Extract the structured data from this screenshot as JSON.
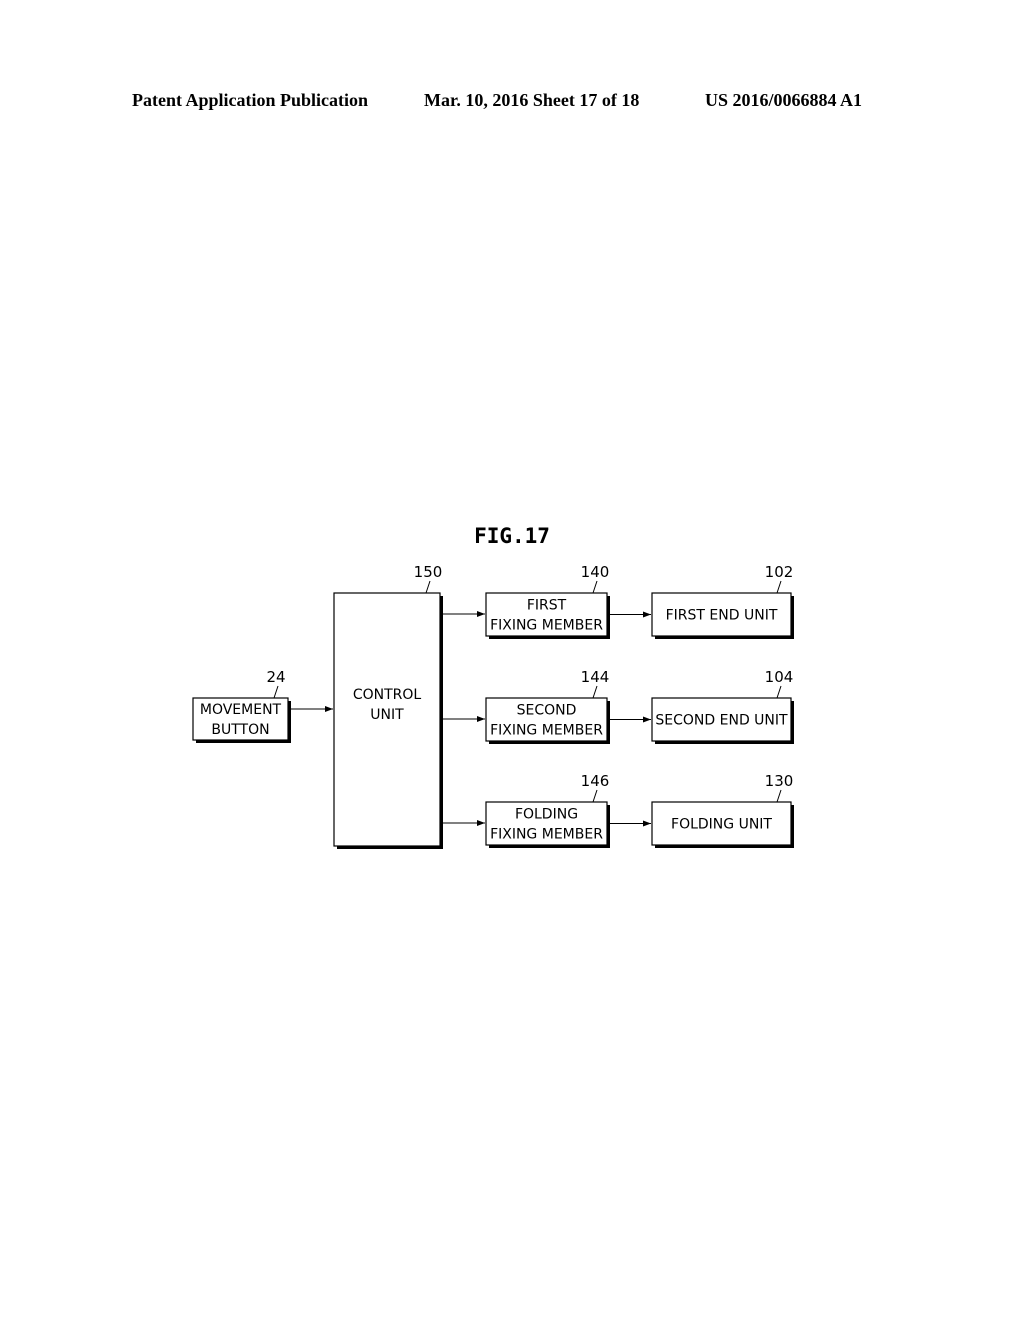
{
  "header": {
    "publication": "Patent Application Publication",
    "date_sheet": "Mar. 10, 2016  Sheet 17 of 18",
    "number": "US 2016/0066884 A1"
  },
  "figure": {
    "title": "FIG.17",
    "blocks": {
      "movement_button": {
        "ref": "24",
        "lines": [
          "MOVEMENT",
          "BUTTON"
        ]
      },
      "control_unit": {
        "ref": "150",
        "lines": [
          "CONTROL",
          "UNIT"
        ]
      },
      "first_fixing": {
        "ref": "140",
        "lines": [
          "FIRST",
          "FIXING MEMBER"
        ]
      },
      "second_fixing": {
        "ref": "144",
        "lines": [
          "SECOND",
          "FIXING MEMBER"
        ]
      },
      "folding_fixing": {
        "ref": "146",
        "lines": [
          "FOLDING",
          "FIXING MEMBER"
        ]
      },
      "first_end": {
        "ref": "102",
        "lines": [
          "FIRST END UNIT"
        ]
      },
      "second_end": {
        "ref": "104",
        "lines": [
          "SECOND END UNIT"
        ]
      },
      "folding_unit": {
        "ref": "130",
        "lines": [
          "FOLDING UNIT"
        ]
      }
    },
    "connections": [
      [
        "movement_button",
        "control_unit"
      ],
      [
        "control_unit",
        "first_fixing"
      ],
      [
        "control_unit",
        "second_fixing"
      ],
      [
        "control_unit",
        "folding_fixing"
      ],
      [
        "first_fixing",
        "first_end"
      ],
      [
        "second_fixing",
        "second_end"
      ],
      [
        "folding_fixing",
        "folding_unit"
      ]
    ]
  }
}
